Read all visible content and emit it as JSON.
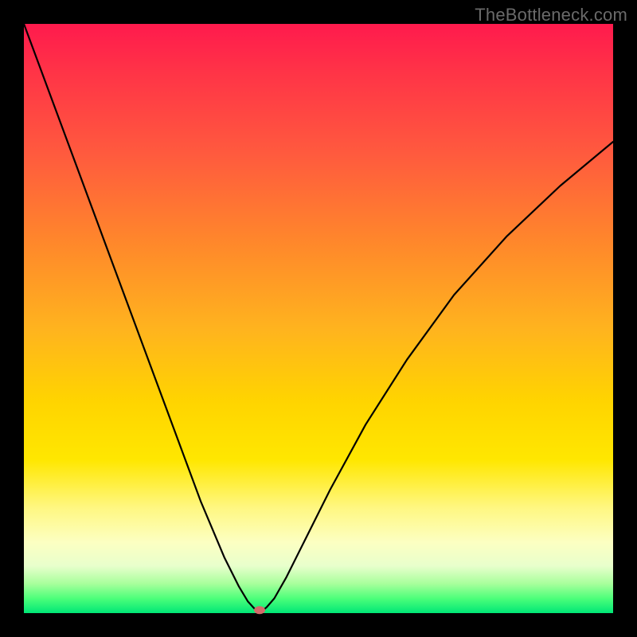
{
  "watermark": "TheBottleneck.com",
  "colors": {
    "frame": "#000000",
    "gradient_top": "#ff1a4d",
    "gradient_mid": "#ffd400",
    "gradient_bottom": "#00e676",
    "curve": "#000000",
    "marker": "#d46a6a"
  },
  "chart_data": {
    "type": "line",
    "title": "",
    "xlabel": "",
    "ylabel": "",
    "xlim": [
      0,
      100
    ],
    "ylim": [
      0,
      100
    ],
    "grid": false,
    "legend": false,
    "series": [
      {
        "name": "bottleneck-curve",
        "x_frac": [
          0.0,
          0.05,
          0.1,
          0.15,
          0.2,
          0.25,
          0.3,
          0.34,
          0.365,
          0.38,
          0.39,
          0.395,
          0.4,
          0.405,
          0.412,
          0.425,
          0.445,
          0.475,
          0.52,
          0.58,
          0.65,
          0.73,
          0.82,
          0.91,
          1.0
        ],
        "y_frac": [
          0.0,
          0.135,
          0.27,
          0.405,
          0.54,
          0.675,
          0.81,
          0.905,
          0.955,
          0.98,
          0.991,
          0.996,
          0.999,
          0.996,
          0.99,
          0.975,
          0.94,
          0.88,
          0.79,
          0.68,
          0.57,
          0.46,
          0.36,
          0.275,
          0.2
        ]
      }
    ],
    "marker": {
      "x_frac": 0.4,
      "y_frac": 0.999
    },
    "description": "V-shaped bottleneck curve over red-to-green vertical gradient; minimum (best match) near x≈0.40 at the bottom edge. Left branch is roughly linear from top-left to the trough; right branch rises with decreasing slope toward the right edge at about 20% from the top."
  }
}
